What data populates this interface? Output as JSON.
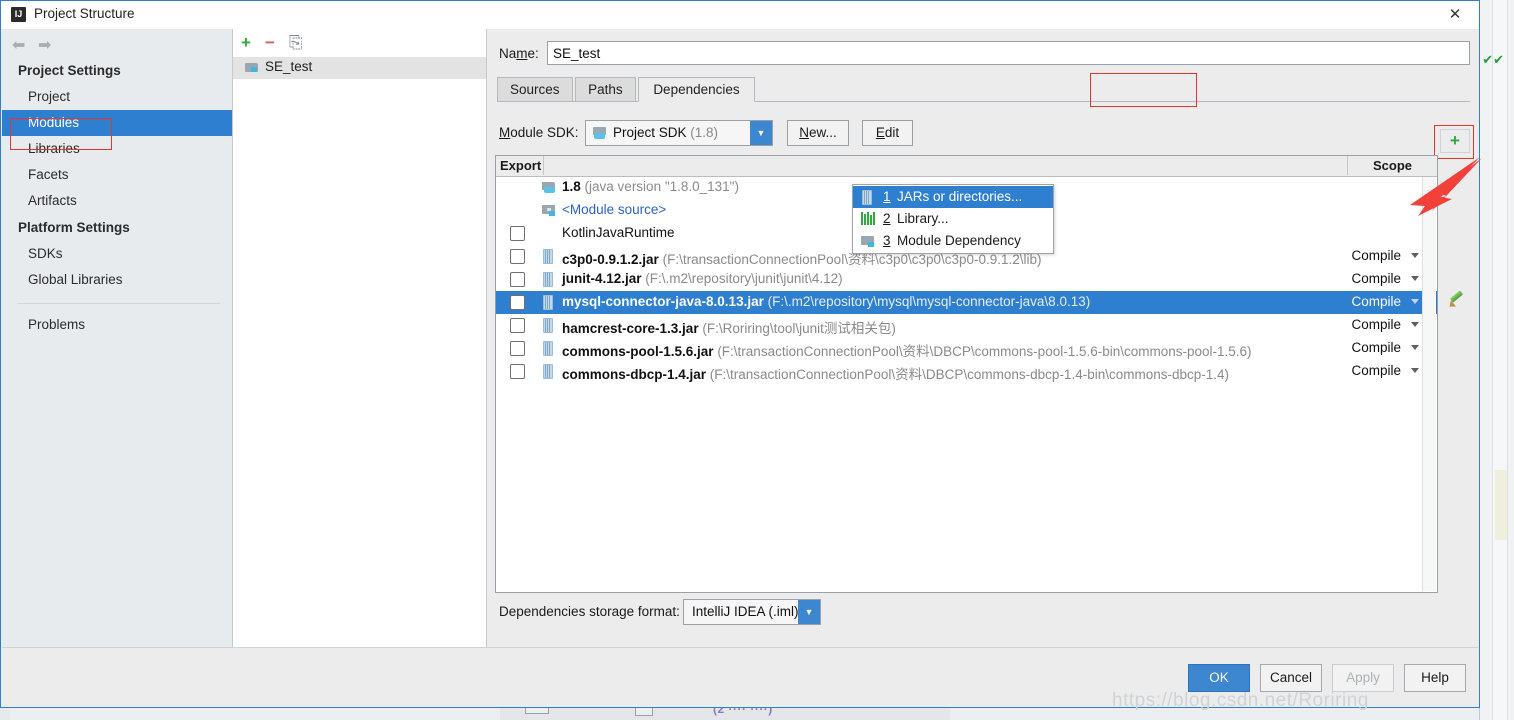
{
  "window": {
    "title": "Project Structure",
    "app_icon": "IJ",
    "close_icon": "✕"
  },
  "sidebar": {
    "back_icon": "⬅",
    "forward_icon": "➡",
    "groups": [
      {
        "header": "Project Settings",
        "items": [
          {
            "label": "Project",
            "selected": false
          },
          {
            "label": "Modules",
            "selected": true
          },
          {
            "label": "Libraries",
            "selected": false
          },
          {
            "label": "Facets",
            "selected": false
          },
          {
            "label": "Artifacts",
            "selected": false
          }
        ]
      },
      {
        "header": "Platform Settings",
        "items": [
          {
            "label": "SDKs",
            "selected": false
          },
          {
            "label": "Global Libraries",
            "selected": false
          }
        ]
      }
    ],
    "problems_label": "Problems"
  },
  "modules_panel": {
    "toolbar": {
      "add_icon": "+",
      "remove_icon": "−",
      "copy_icon": "⎘"
    },
    "items": [
      {
        "label": "SE_test",
        "selected": true
      }
    ]
  },
  "name_field": {
    "label": "Name:",
    "label_mnemonic": "m",
    "value": "SE_test"
  },
  "tabs": [
    {
      "label": "Sources",
      "active": false
    },
    {
      "label": "Paths",
      "active": false
    },
    {
      "label": "Dependencies",
      "active": true
    }
  ],
  "module_sdk": {
    "label": "Module SDK:",
    "value": "Project SDK",
    "value_suffix": "(1.8)",
    "new_button": "New...",
    "edit_button": "Edit",
    "dropdown_arrow": "▼"
  },
  "table": {
    "columns": {
      "export": "Export",
      "scope": "Scope"
    },
    "rows": [
      {
        "icon": "folder-sdk-icon",
        "checkbox": false,
        "has_checkbox": false,
        "name": "1.8",
        "path": "(java version \"1.8.0_131\")",
        "scope": "",
        "selected": false,
        "style": "sdk"
      },
      {
        "icon": "module-source-icon",
        "checkbox": false,
        "has_checkbox": false,
        "name": "<Module source>",
        "path": "",
        "scope": "",
        "selected": false,
        "style": "modsrc"
      },
      {
        "icon": "kotlin-icon",
        "checkbox": false,
        "has_checkbox": true,
        "name": "KotlinJavaRuntime",
        "path": "",
        "scope": "",
        "selected": false,
        "style": "plain"
      },
      {
        "icon": "jar-icon",
        "checkbox": false,
        "has_checkbox": true,
        "name": "c3p0-0.9.1.2.jar",
        "path": "(F:\\transactionConnectionPool\\资料\\c3p0\\c3p0\\c3p0-0.9.1.2\\lib)",
        "scope": "Compile",
        "selected": false,
        "style": "plain"
      },
      {
        "icon": "jar-icon",
        "checkbox": false,
        "has_checkbox": true,
        "name": "junit-4.12.jar",
        "path": "(F:\\.m2\\repository\\junit\\junit\\4.12)",
        "scope": "Compile",
        "selected": false,
        "style": "plain"
      },
      {
        "icon": "jar-icon",
        "checkbox": false,
        "has_checkbox": true,
        "name": "mysql-connector-java-8.0.13.jar",
        "path": "(F:\\.m2\\repository\\mysql\\mysql-connector-java\\8.0.13)",
        "scope": "Compile",
        "selected": true,
        "style": "plain"
      },
      {
        "icon": "jar-icon",
        "checkbox": false,
        "has_checkbox": true,
        "name": "hamcrest-core-1.3.jar",
        "path": "(F:\\Roriring\\tool\\junit测试相关包)",
        "scope": "Compile",
        "selected": false,
        "style": "plain"
      },
      {
        "icon": "jar-icon",
        "checkbox": false,
        "has_checkbox": true,
        "name": "commons-pool-1.5.6.jar",
        "path": "(F:\\transactionConnectionPool\\资料\\DBCP\\commons-pool-1.5.6-bin\\commons-pool-1.5.6)",
        "scope": "Compile",
        "selected": false,
        "style": "plain"
      },
      {
        "icon": "jar-icon",
        "checkbox": false,
        "has_checkbox": true,
        "name": "commons-dbcp-1.4.jar",
        "path": "(F:\\transactionConnectionPool\\资料\\DBCP\\commons-dbcp-1.4-bin\\commons-dbcp-1.4)",
        "scope": "Compile",
        "selected": false,
        "style": "plain"
      }
    ],
    "add_button_icon": "+",
    "edit_pencil_icon": "pencil-icon"
  },
  "add_menu": {
    "items": [
      {
        "num": "1",
        "label": "JARs or directories...",
        "icon": "jar-icon",
        "highlighted": true
      },
      {
        "num": "2",
        "label": "Library...",
        "icon": "library-icon",
        "highlighted": false
      },
      {
        "num": "3",
        "label": "Module Dependency",
        "icon": "module-icon",
        "highlighted": false
      }
    ]
  },
  "storage_format": {
    "label": "Dependencies storage format:",
    "value": "IntelliJ IDEA (.iml)",
    "dropdown_arrow": "▼"
  },
  "buttons": {
    "ok": "OK",
    "cancel": "Cancel",
    "apply": "Apply",
    "help": "Help"
  },
  "watermark": "https://blog.csdn.net/Roriring",
  "colors": {
    "accent": "#2f7fd1",
    "annotation_red": "#e8342b",
    "green_add": "#2faa3c",
    "path_gray": "#8a8a8a"
  }
}
